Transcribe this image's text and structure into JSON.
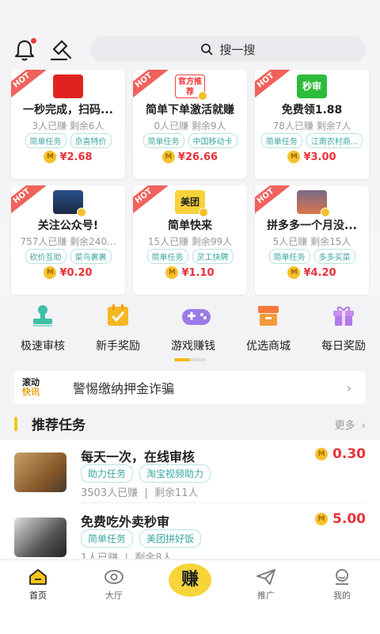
{
  "header": {
    "search_placeholder": "搜一搜"
  },
  "cards": [
    {
      "title": "一秒完成，扫码...",
      "stats": "3人已赚  剩余6人",
      "tags": [
        "简单任务",
        "京喜特价"
      ],
      "price": "¥2.68",
      "hot": "HOT",
      "thumb_text": ""
    },
    {
      "title": "简单下单激活就赚",
      "stats": "0人已赚  剩余9人",
      "tags": [
        "简单任务",
        "中国移动卡"
      ],
      "price": "¥26.66",
      "hot": "HOT",
      "thumb_text": "官方推荐"
    },
    {
      "title": "免费领1.88",
      "stats": "78人已赚  剩余7人",
      "tags": [
        "简单任务",
        "江南农村商..."
      ],
      "price": "¥3.00",
      "hot": "HOT",
      "thumb_text": "秒审"
    },
    {
      "title": "关注公众号!",
      "stats": "757人已赚  剩余240...",
      "tags": [
        "砍价互助",
        "菜鸟裹裹"
      ],
      "price": "¥0.20",
      "hot": "HOT",
      "thumb_text": ""
    },
    {
      "title": "简单快来",
      "stats": "15人已赚  剩余99人",
      "tags": [
        "简单任务",
        "灵工快聘"
      ],
      "price": "¥1.10",
      "hot": "HOT",
      "thumb_text": "美团"
    },
    {
      "title": "拼多多一个月没...",
      "stats": "5人已赚  剩余15人",
      "tags": [
        "简单任务",
        "多多买菜"
      ],
      "price": "¥4.20",
      "hot": "HOT",
      "thumb_text": ""
    }
  ],
  "categories": [
    {
      "label": "极速审核",
      "icon": "stamp-icon"
    },
    {
      "label": "新手奖励",
      "icon": "calendar-check-icon"
    },
    {
      "label": "游戏赚钱",
      "icon": "gamepad-icon"
    },
    {
      "label": "优选商城",
      "icon": "box-icon"
    },
    {
      "label": "每日奖励",
      "icon": "gift-icon"
    }
  ],
  "notice": {
    "badge_line1": "滚动",
    "badge_line2": "快讯",
    "text": "警惕缴纳押金诈骗"
  },
  "section": {
    "title": "推荐任务",
    "more": "更多"
  },
  "tasks": [
    {
      "title": "每天一次，在线审核",
      "price": "0.30",
      "tags": [
        "助力任务",
        "淘宝视频助力"
      ],
      "earned": "3503人已赚",
      "remaining": "剩余11人"
    },
    {
      "title": "免费吃外卖秒审",
      "price": "5.00",
      "tags": [
        "简单任务",
        "美团拼好饭"
      ],
      "earned": "1人已赚",
      "remaining": "剩余8人"
    }
  ],
  "tabbar": {
    "home": "首页",
    "hall": "大厅",
    "earn": "赚",
    "promote": "推广",
    "mine": "我的"
  },
  "colors": {
    "accent": "#f5c518",
    "price": "#e8323a",
    "tag": "#3aa6a0",
    "hot": "#f0625c"
  }
}
